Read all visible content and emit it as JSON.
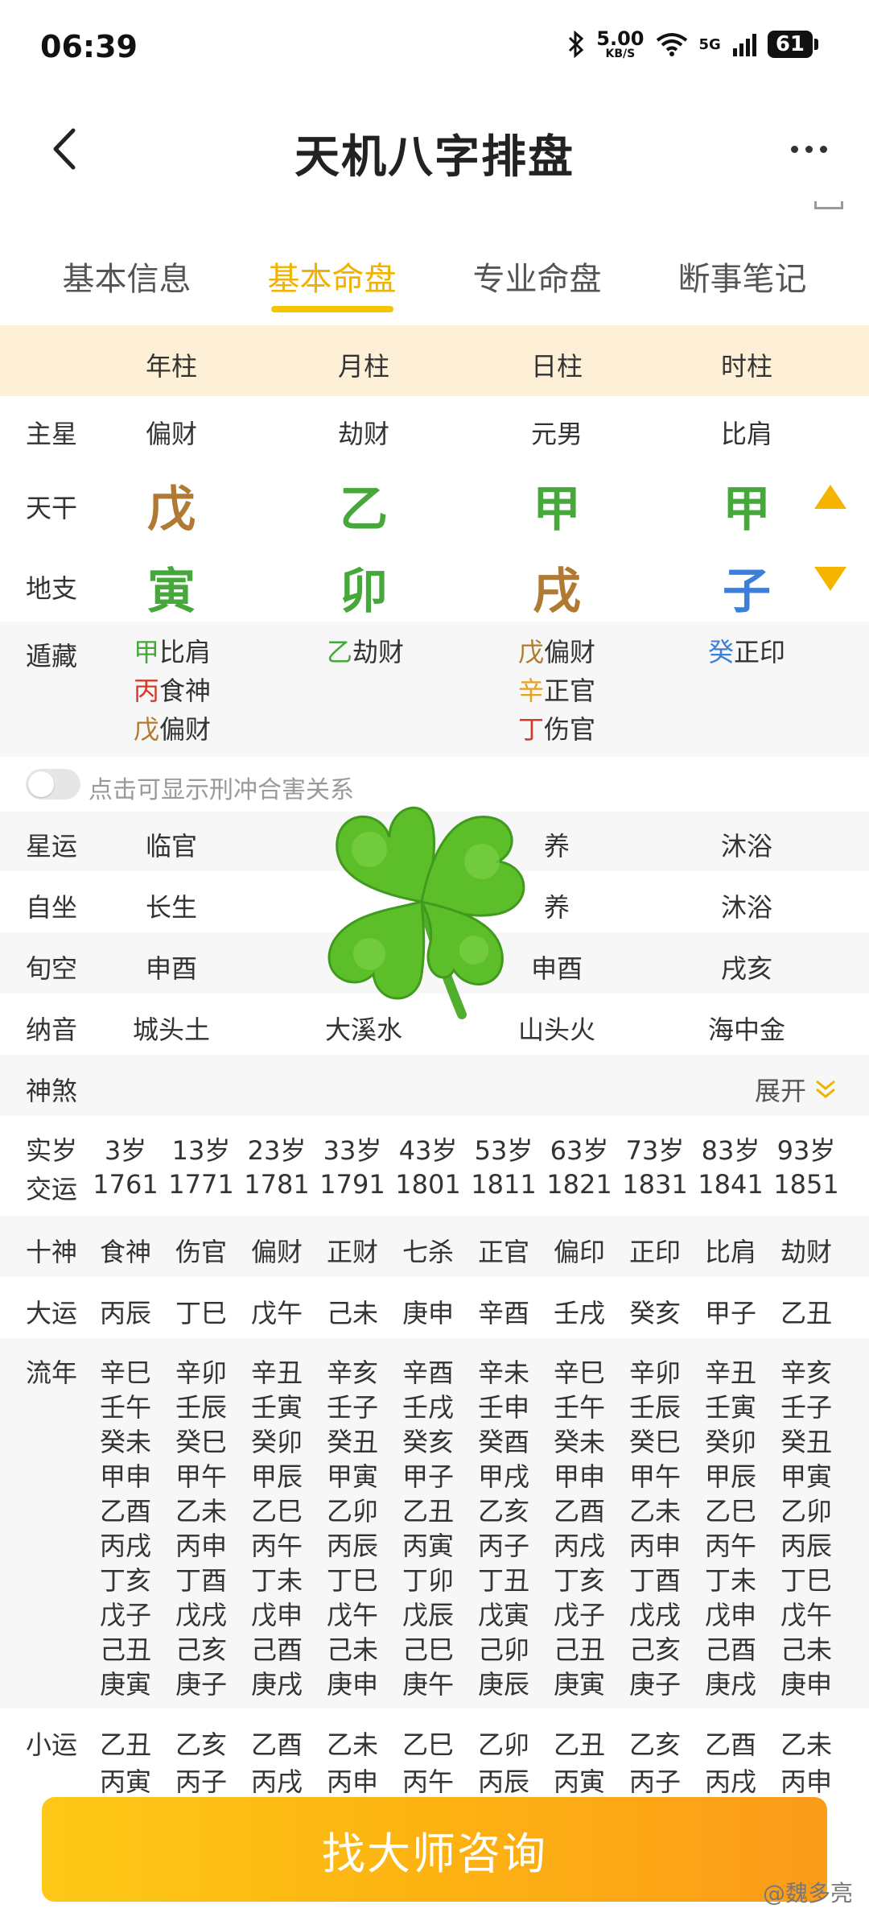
{
  "status": {
    "time": "06:39",
    "speed_value": "5.00",
    "speed_unit": "KB/S",
    "network": "5G",
    "battery": "61"
  },
  "header": {
    "title": "天机八字排盘"
  },
  "tabs": [
    "基本信息",
    "基本命盘",
    "专业命盘",
    "断事笔记"
  ],
  "active_tab": "基本命盘",
  "pillars": {
    "labels": [
      "年柱",
      "月柱",
      "日柱",
      "时柱"
    ]
  },
  "rows": {
    "main_star": {
      "label": "主星",
      "values": [
        "偏财",
        "劫财",
        "元男",
        "比肩"
      ]
    },
    "stem": {
      "label": "天干",
      "values": [
        "戊",
        "乙",
        "甲",
        "甲"
      ],
      "colors": [
        "#b07a32",
        "#46a83b",
        "#46a83b",
        "#46a83b"
      ]
    },
    "branch": {
      "label": "地支",
      "values": [
        "寅",
        "卯",
        "戌",
        "子"
      ],
      "colors": [
        "#46a83b",
        "#46a83b",
        "#b07a32",
        "#3b7fd8"
      ]
    },
    "hidden": {
      "label": "遁藏",
      "year": [
        {
          "c": "甲",
          "g": "比肩"
        },
        {
          "c": "丙",
          "g": "食神"
        },
        {
          "c": "戊",
          "g": "偏财"
        }
      ],
      "month": [
        {
          "c": "乙",
          "g": "劫财"
        }
      ],
      "day": [
        {
          "c": "戊",
          "g": "偏财"
        },
        {
          "c": "辛",
          "g": "正官"
        },
        {
          "c": "丁",
          "g": "伤官"
        }
      ],
      "hour": [
        {
          "c": "癸",
          "g": "正印"
        }
      ]
    },
    "toggle_label": "点击可显示刑冲合害关系",
    "star_luck": {
      "label": "星运",
      "values": [
        "临官",
        "",
        "养",
        "沐浴"
      ]
    },
    "self_sit": {
      "label": "自坐",
      "values": [
        "长生",
        "",
        "养",
        "沐浴"
      ]
    },
    "xun_kong": {
      "label": "旬空",
      "values": [
        "申酉",
        "",
        "申酉",
        "戌亥"
      ]
    },
    "na_yin": {
      "label": "纳音",
      "values": [
        "城头土",
        "大溪水",
        "山头火",
        "海中金"
      ]
    },
    "shen_sha": {
      "label": "神煞",
      "expand": "展开"
    }
  },
  "luck": {
    "age_label": "实岁",
    "ages": [
      "3岁",
      "13岁",
      "23岁",
      "33岁",
      "43岁",
      "53岁",
      "63岁",
      "73岁",
      "83岁",
      "93岁"
    ],
    "year_label": "交运",
    "years": [
      "1761",
      "1771",
      "1781",
      "1791",
      "1801",
      "1811",
      "1821",
      "1831",
      "1841",
      "1851"
    ],
    "ten_gods_label": "十神",
    "ten_gods": [
      "食神",
      "伤官",
      "偏财",
      "正财",
      "七杀",
      "正官",
      "偏印",
      "正印",
      "比肩",
      "劫财"
    ],
    "da_yun_label": "大运",
    "da_yun": [
      "丙辰",
      "丁巳",
      "戊午",
      "己未",
      "庚申",
      "辛酉",
      "壬戌",
      "癸亥",
      "甲子",
      "乙丑"
    ],
    "liu_nian_label": "流年",
    "liu_nian": [
      [
        "辛巳",
        "壬午",
        "癸未",
        "甲申",
        "乙酉",
        "丙戌",
        "丁亥",
        "戊子",
        "己丑",
        "庚寅"
      ],
      [
        "辛卯",
        "壬辰",
        "癸巳",
        "甲午",
        "乙未",
        "丙申",
        "丁酉",
        "戊戌",
        "己亥",
        "庚子"
      ],
      [
        "辛丑",
        "壬寅",
        "癸卯",
        "甲辰",
        "乙巳",
        "丙午",
        "丁未",
        "戊申",
        "己酉",
        "庚戌"
      ],
      [
        "辛亥",
        "壬子",
        "癸丑",
        "甲寅",
        "乙卯",
        "丙辰",
        "丁巳",
        "戊午",
        "己未",
        "庚申"
      ],
      [
        "辛酉",
        "壬戌",
        "癸亥",
        "甲子",
        "乙丑",
        "丙寅",
        "丁卯",
        "戊辰",
        "己巳",
        "庚午"
      ],
      [
        "辛未",
        "壬申",
        "癸酉",
        "甲戌",
        "乙亥",
        "丙子",
        "丁丑",
        "戊寅",
        "己卯",
        "庚辰"
      ],
      [
        "辛巳",
        "壬午",
        "癸未",
        "甲申",
        "乙酉",
        "丙戌",
        "丁亥",
        "戊子",
        "己丑",
        "庚寅"
      ],
      [
        "辛卯",
        "壬辰",
        "癸巳",
        "甲午",
        "乙未",
        "丙申",
        "丁酉",
        "戊戌",
        "己亥",
        "庚子"
      ],
      [
        "辛丑",
        "壬寅",
        "癸卯",
        "甲辰",
        "乙巳",
        "丙午",
        "丁未",
        "戊申",
        "己酉",
        "庚戌"
      ],
      [
        "辛亥",
        "壬子",
        "癸丑",
        "甲寅",
        "乙卯",
        "丙辰",
        "丁巳",
        "戊午",
        "己未",
        "庚申"
      ]
    ],
    "xiao_yun_label": "小运",
    "xiao_yun": [
      [
        "乙丑",
        "丙寅"
      ],
      [
        "乙亥",
        "丙子"
      ],
      [
        "乙酉",
        "丙戌"
      ],
      [
        "乙未",
        "丙申"
      ],
      [
        "乙巳",
        "丙午"
      ],
      [
        "乙卯",
        "丙辰"
      ],
      [
        "乙丑",
        "丙寅"
      ],
      [
        "乙亥",
        "丙子"
      ],
      [
        "乙酉",
        "丙戌"
      ],
      [
        "乙未",
        "丙申"
      ]
    ]
  },
  "cta": {
    "label": "找大师咨询"
  },
  "watermark": "@魏多亮",
  "colors": {
    "accent": "#f5c400",
    "header_bg": "#fdf0d7",
    "cta_start": "#fdc817",
    "cta_end": "#fb9b1a"
  }
}
